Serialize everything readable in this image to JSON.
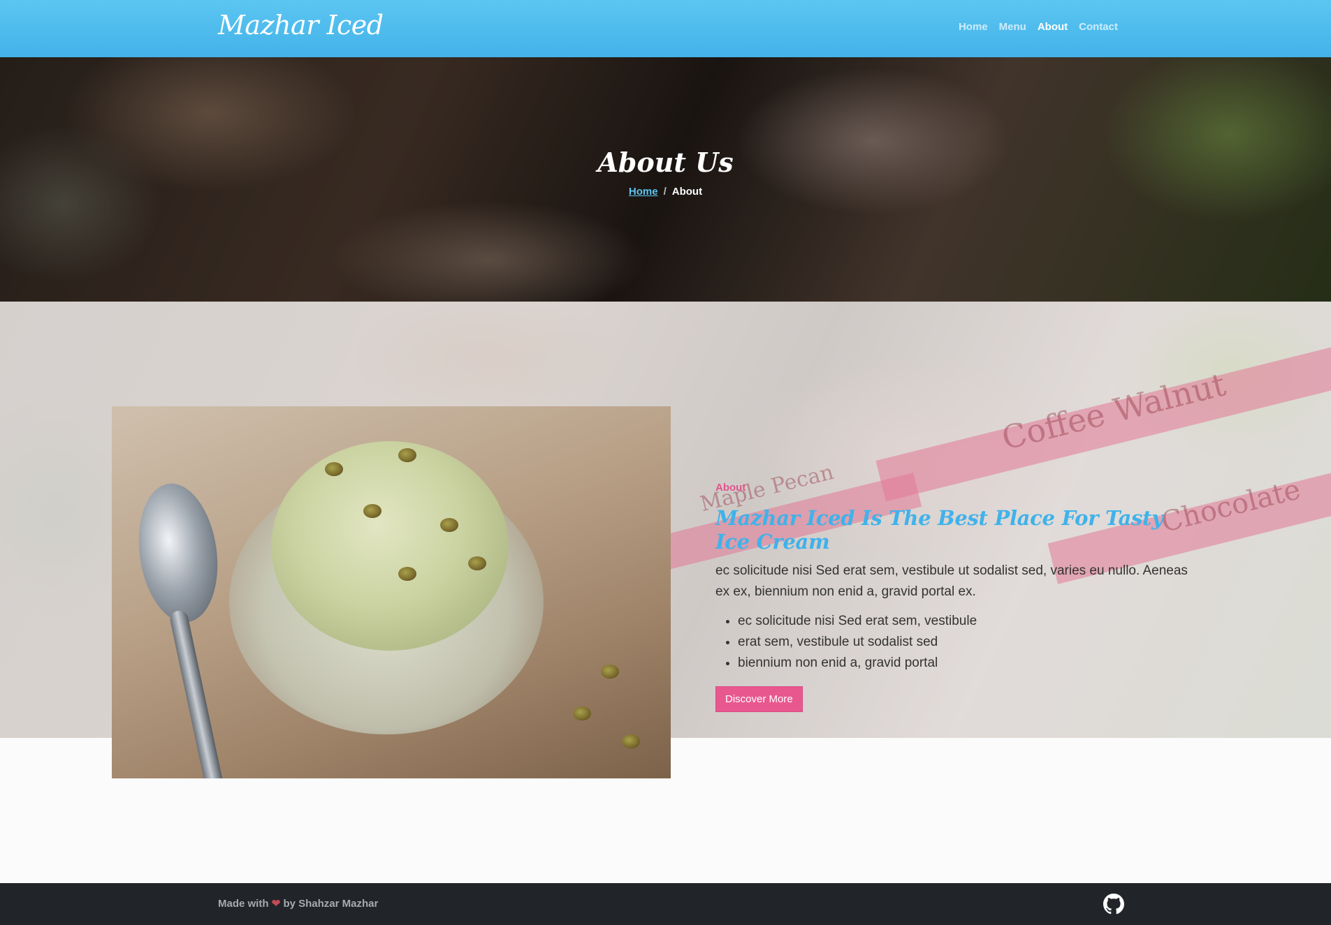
{
  "navbar": {
    "brand": "Mazhar Iced",
    "links": [
      {
        "label": "Home"
      },
      {
        "label": "Menu"
      },
      {
        "label": "About"
      },
      {
        "label": "Contact"
      }
    ]
  },
  "hero": {
    "title": "About Us",
    "breadcrumb": {
      "home": "Home",
      "separator": "/",
      "current": "About"
    }
  },
  "about": {
    "kicker": "About",
    "heading": "Mazhar Iced Is The Best Place For Tasty Ice Cream",
    "paragraph": "ec solicitude nisi Sed erat sem, vestibule ut sodalist sed, varies eu nullo. Aeneas ex ex, biennium non enid a, gravid portal ex.",
    "bullets": [
      "ec solicitude nisi Sed erat sem, vestibule",
      "erat sem, vestibule ut sodalist sed",
      "biennium non enid a, gravid portal"
    ],
    "button_label": "Discover More",
    "background_labels": [
      "Coffee Walnut",
      "Maple Pecan",
      "Chocolate"
    ]
  },
  "footer": {
    "made_with": "Made with",
    "heart": "❤",
    "by": "by Shahzar Mazhar",
    "icon": "github-icon"
  },
  "colors": {
    "accent_blue": "#43b2e9",
    "accent_pink": "#e8588f",
    "footer_bg": "#212529"
  }
}
